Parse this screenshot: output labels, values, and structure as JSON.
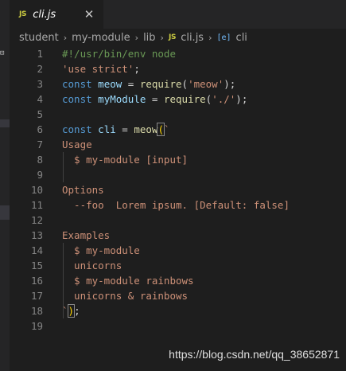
{
  "colors": {
    "background": "#1e1e1e",
    "keyword": "#569cd6",
    "string": "#ce9178",
    "comment": "#6a9955",
    "function": "#dcdcaa",
    "variable": "#9cdcfe",
    "js_badge": "#cbcb41"
  },
  "tab": {
    "icon": "JS",
    "label": "cli.js",
    "close_icon": "close-icon"
  },
  "breadcrumb": {
    "items": [
      "student",
      "my-module",
      "lib",
      "cli.js",
      "cli"
    ],
    "file_icon": "JS",
    "symbol_icon": "[e]"
  },
  "left_strip": {
    "mark": "⊡"
  },
  "editor": {
    "lines": [
      {
        "n": "1",
        "tokens": [
          {
            "t": "#!/usr/bin/env node",
            "c": "comment"
          }
        ]
      },
      {
        "n": "2",
        "tokens": [
          {
            "t": "'use strict'",
            "c": "string"
          },
          {
            "t": ";",
            "c": "plain"
          }
        ]
      },
      {
        "n": "3",
        "tokens": [
          {
            "t": "const",
            "c": "keyword"
          },
          {
            "t": " ",
            "c": "plain"
          },
          {
            "t": "meow",
            "c": "variable"
          },
          {
            "t": " = ",
            "c": "plain"
          },
          {
            "t": "require",
            "c": "function"
          },
          {
            "t": "(",
            "c": "plain"
          },
          {
            "t": "'meow'",
            "c": "string"
          },
          {
            "t": ");",
            "c": "plain"
          }
        ]
      },
      {
        "n": "4",
        "tokens": [
          {
            "t": "const",
            "c": "keyword"
          },
          {
            "t": " ",
            "c": "plain"
          },
          {
            "t": "myModule",
            "c": "variable"
          },
          {
            "t": " = ",
            "c": "plain"
          },
          {
            "t": "require",
            "c": "function"
          },
          {
            "t": "(",
            "c": "plain"
          },
          {
            "t": "'./'",
            "c": "string"
          },
          {
            "t": ");",
            "c": "plain"
          }
        ]
      },
      {
        "n": "5",
        "tokens": []
      },
      {
        "n": "6",
        "tokens": [
          {
            "t": "const",
            "c": "keyword"
          },
          {
            "t": " ",
            "c": "plain"
          },
          {
            "t": "cli",
            "c": "variable"
          },
          {
            "t": " = ",
            "c": "plain"
          },
          {
            "t": "meow",
            "c": "function"
          },
          {
            "t": "(",
            "c": "bracket"
          },
          {
            "t": "`",
            "c": "string"
          }
        ]
      },
      {
        "n": "7",
        "tokens": [
          {
            "t": "Usage",
            "c": "string"
          }
        ]
      },
      {
        "n": "8",
        "tokens": [
          {
            "t": "  $ my-module [input]",
            "c": "string"
          }
        ]
      },
      {
        "n": "9",
        "tokens": []
      },
      {
        "n": "10",
        "tokens": [
          {
            "t": "Options",
            "c": "string"
          }
        ]
      },
      {
        "n": "11",
        "tokens": [
          {
            "t": "  --foo  Lorem ipsum. [Default: false]",
            "c": "string"
          }
        ]
      },
      {
        "n": "12",
        "tokens": []
      },
      {
        "n": "13",
        "tokens": [
          {
            "t": "Examples",
            "c": "string"
          }
        ]
      },
      {
        "n": "14",
        "tokens": [
          {
            "t": "  $ my-module",
            "c": "string"
          }
        ]
      },
      {
        "n": "15",
        "tokens": [
          {
            "t": "  unicorns",
            "c": "string"
          }
        ]
      },
      {
        "n": "16",
        "tokens": [
          {
            "t": "  $ my-module rainbows",
            "c": "string"
          }
        ]
      },
      {
        "n": "17",
        "tokens": [
          {
            "t": "  unicorns & rainbows",
            "c": "string"
          }
        ]
      },
      {
        "n": "18",
        "tokens": [
          {
            "t": "`",
            "c": "string"
          },
          {
            "t": ")",
            "c": "bracket"
          },
          {
            "t": ";",
            "c": "plain"
          }
        ]
      },
      {
        "n": "19",
        "tokens": []
      }
    ]
  },
  "watermark": "https://blog.csdn.net/qq_38652871"
}
